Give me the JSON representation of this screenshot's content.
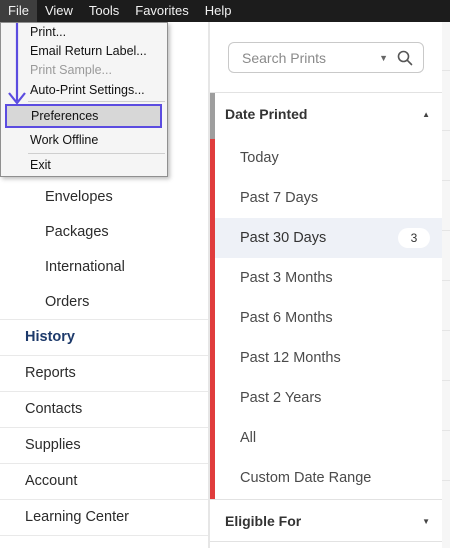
{
  "menubar": {
    "items": [
      "File",
      "View",
      "Tools",
      "Favorites",
      "Help"
    ]
  },
  "file_menu": {
    "items": [
      {
        "label": "Print...",
        "disabled": false
      },
      {
        "label": "Email Return Label...",
        "disabled": false
      },
      {
        "label": "Print Sample...",
        "disabled": true
      },
      {
        "label": "Auto-Print Settings...",
        "disabled": false
      },
      {
        "label": "Preferences",
        "disabled": false,
        "highlighted": true
      },
      {
        "label": "Work Offline",
        "disabled": false
      },
      {
        "label": "Exit",
        "disabled": false
      }
    ]
  },
  "sidebar": {
    "sub_items": [
      "Envelopes",
      "Packages",
      "International",
      "Orders"
    ],
    "items": [
      "History",
      "Reports",
      "Contacts",
      "Supplies",
      "Account",
      "Learning Center"
    ]
  },
  "filter": {
    "search_placeholder": "Search Prints",
    "date_section": {
      "title": "Date Printed",
      "options": [
        "Today",
        "Past 7 Days",
        "Past 30 Days",
        "Past 3 Months",
        "Past 6 Months",
        "Past 12 Months",
        "Past 2 Years",
        "All",
        "Custom Date Range"
      ],
      "selected": "Past 30 Days",
      "selected_count": "3"
    },
    "eligible_section": {
      "title": "Eligible For"
    }
  },
  "colors": {
    "accent_red": "#e03c3c",
    "highlight_border": "#5b4ce0",
    "active_nav": "#1d3a6b"
  }
}
